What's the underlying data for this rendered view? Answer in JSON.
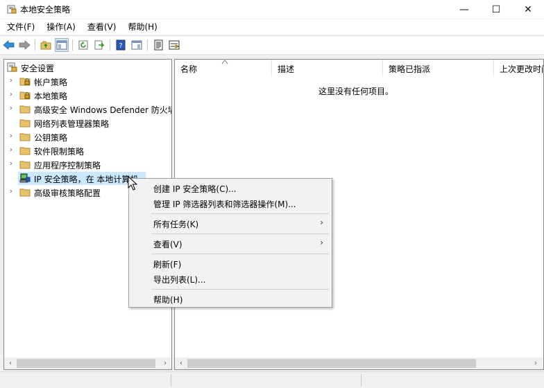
{
  "window": {
    "title": "本地安全策略"
  },
  "controls": {
    "minimize": "—",
    "maximize": "☐",
    "close": "✕"
  },
  "menu": [
    "文件(F)",
    "操作(A)",
    "查看(V)",
    "帮助(H)"
  ],
  "tree": [
    {
      "label": "安全设置",
      "level": 0,
      "expander": "",
      "icon": "security-settings-icon"
    },
    {
      "label": "帐户策略",
      "level": 1,
      "expander": "›",
      "icon": "locked-folder-icon"
    },
    {
      "label": "本地策略",
      "level": 1,
      "expander": "›",
      "icon": "locked-folder-icon"
    },
    {
      "label": "高级安全 Windows Defender 防火墙",
      "level": 1,
      "expander": "›",
      "icon": "folder-icon"
    },
    {
      "label": "网络列表管理器策略",
      "level": 1,
      "expander": "",
      "icon": "folder-icon"
    },
    {
      "label": "公钥策略",
      "level": 1,
      "expander": "›",
      "icon": "folder-icon"
    },
    {
      "label": "软件限制策略",
      "level": 1,
      "expander": "›",
      "icon": "folder-icon"
    },
    {
      "label": "应用程序控制策略",
      "level": 1,
      "expander": "›",
      "icon": "folder-icon"
    },
    {
      "label": "IP 安全策略，在 本地计算机",
      "level": 1,
      "expander": "",
      "icon": "ip-security-icon",
      "selected": true
    },
    {
      "label": "高级审核策略配置",
      "level": 1,
      "expander": "›",
      "icon": "folder-icon"
    }
  ],
  "columns": [
    "名称",
    "描述",
    "策略已指派",
    "上次更改时间"
  ],
  "empty_message": "这里没有任何项目。",
  "context_menu": [
    {
      "label": "创建 IP 安全策略(C)...",
      "submenu": false
    },
    {
      "label": "管理 IP 筛选器列表和筛选器操作(M)...",
      "submenu": false
    },
    {
      "sep": true
    },
    {
      "label": "所有任务(K)",
      "submenu": true
    },
    {
      "sep": true
    },
    {
      "label": "查看(V)",
      "submenu": true
    },
    {
      "sep": true
    },
    {
      "label": "刷新(F)",
      "submenu": false
    },
    {
      "label": "导出列表(L)...",
      "submenu": false
    },
    {
      "sep": true
    },
    {
      "label": "帮助(H)",
      "submenu": false
    }
  ],
  "scroll": {
    "left": "‹",
    "right": "›"
  },
  "colors": {
    "selection": "#cce8ff",
    "folder": "#e8c26a"
  }
}
